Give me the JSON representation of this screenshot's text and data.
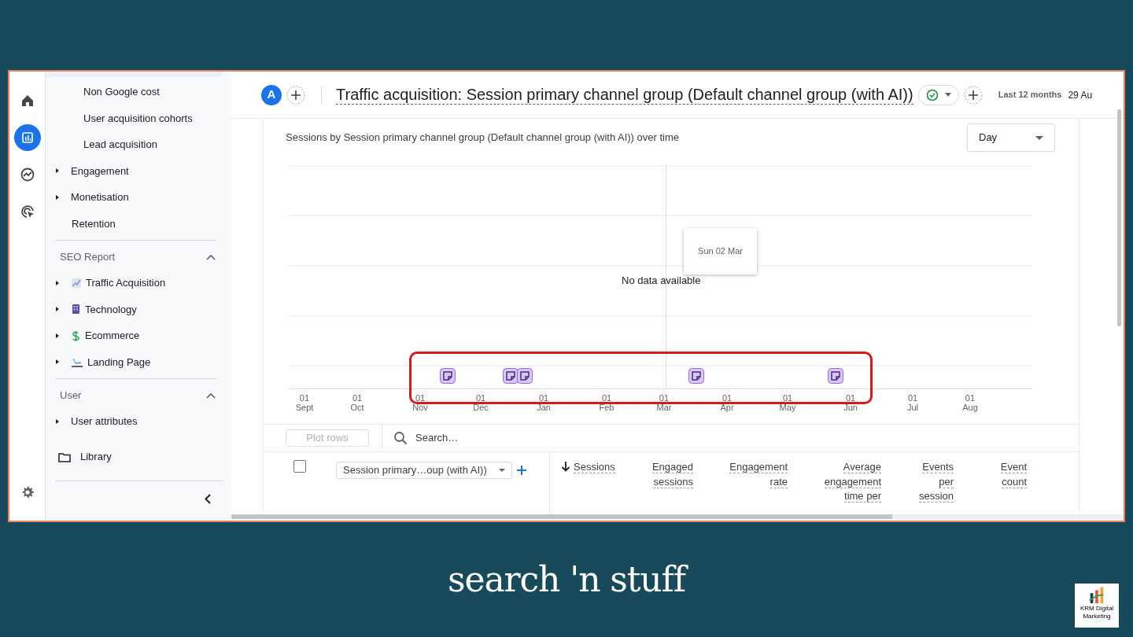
{
  "rail": [
    {
      "kind": "home",
      "selected": false
    },
    {
      "kind": "reports",
      "selected": true
    },
    {
      "kind": "explore",
      "selected": false
    },
    {
      "kind": "advertising",
      "selected": false
    }
  ],
  "sidebar": {
    "items": [
      {
        "label": "Non Google cost",
        "kind": "sub"
      },
      {
        "label": "User acquisition cohorts",
        "kind": "sub"
      },
      {
        "label": "Lead acquisition",
        "kind": "sub"
      },
      {
        "label": "Engagement",
        "kind": "folder"
      },
      {
        "label": "Monetisation",
        "kind": "folder"
      },
      {
        "label": "Retention",
        "kind": "leaf"
      }
    ],
    "sections": [
      {
        "title": "SEO Report",
        "expanded": true,
        "items": [
          {
            "label": "Traffic Acquisition",
            "kind": "folder"
          },
          {
            "label": "Technology",
            "kind": "folder"
          },
          {
            "label": "Ecommerce",
            "kind": "folder"
          },
          {
            "label": "Landing Page",
            "kind": "folder"
          }
        ]
      },
      {
        "title": "User",
        "expanded": true,
        "items": [
          {
            "label": "User attributes",
            "kind": "folder"
          }
        ]
      }
    ],
    "library": "Library"
  },
  "header": {
    "avatar": "A",
    "title": "Traffic acquisition: Session primary channel group (Default channel group (with AI))",
    "date_range": "Last 12 months",
    "date_end": "29 Au"
  },
  "chart": {
    "title": "Sessions by Session primary channel group (Default channel group (with AI)) over time",
    "granularity": "Day",
    "message": "No data available",
    "tooltip": "Sun 02 Mar",
    "x_labels": [
      {
        "day": "01",
        "month": "Sept"
      },
      {
        "day": "01",
        "month": "Oct"
      },
      {
        "day": "01",
        "month": "Nov"
      },
      {
        "day": "01",
        "month": "Dec"
      },
      {
        "day": "01",
        "month": "Jan"
      },
      {
        "day": "01",
        "month": "Feb"
      },
      {
        "day": "01",
        "month": "Mar"
      },
      {
        "day": "01",
        "month": "Apr"
      },
      {
        "day": "01",
        "month": "May"
      },
      {
        "day": "01",
        "month": "Jun"
      },
      {
        "day": "01",
        "month": "Jul"
      },
      {
        "day": "01",
        "month": "Aug"
      }
    ]
  },
  "table": {
    "plot_button": "Plot rows",
    "search_placeholder": "Search…",
    "select_all": {
      "checked": false
    },
    "dimension": "Session primary…oup (with AI))",
    "columns": [
      {
        "lines": [
          "Sessions"
        ],
        "sorted": true
      },
      {
        "lines": [
          "Engaged",
          "sessions"
        ],
        "sorted": false
      },
      {
        "lines": [
          "Engagement",
          "rate"
        ],
        "sorted": false
      },
      {
        "lines": [
          "Average",
          "engagement",
          "time per"
        ],
        "sorted": false
      },
      {
        "lines": [
          "Events",
          "per",
          "session"
        ],
        "sorted": false
      },
      {
        "lines": [
          "Event",
          "count"
        ],
        "sorted": false
      }
    ]
  },
  "footer": {
    "brand": "search 'n stuff",
    "logo_lines": [
      "KRM Digital",
      "Marketing"
    ]
  }
}
